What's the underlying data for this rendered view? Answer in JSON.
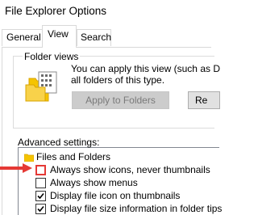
{
  "window": {
    "title": "File Explorer Options"
  },
  "tabs": [
    {
      "label": "General",
      "selected": false
    },
    {
      "label": "View",
      "selected": true
    },
    {
      "label": "Search",
      "selected": false
    }
  ],
  "folder_views": {
    "label": "Folder views",
    "description_line1": "You can apply this view (such as D",
    "description_line2": "all folders of this type.",
    "apply_button": "Apply to Folders",
    "reset_button": "Re"
  },
  "advanced": {
    "label": "Advanced settings:",
    "items": [
      {
        "label": "Files and Folders",
        "type": "folder"
      },
      {
        "label": "Always show icons, never thumbnails",
        "type": "checkbox",
        "checked": false,
        "highlighted": true
      },
      {
        "label": "Always show menus",
        "type": "checkbox",
        "checked": false
      },
      {
        "label": "Display file icon on thumbnails",
        "type": "checkbox",
        "checked": true
      },
      {
        "label": "Display file size information in folder tips",
        "type": "checkbox",
        "checked": true
      }
    ]
  },
  "colors": {
    "highlight": "#e53935",
    "folder": "#f5c400",
    "disabled_text": "#7a7a7a"
  },
  "icons": [
    "folder-views-icon",
    "folder-icon",
    "checkmark-icon",
    "red-arrow-icon"
  ]
}
